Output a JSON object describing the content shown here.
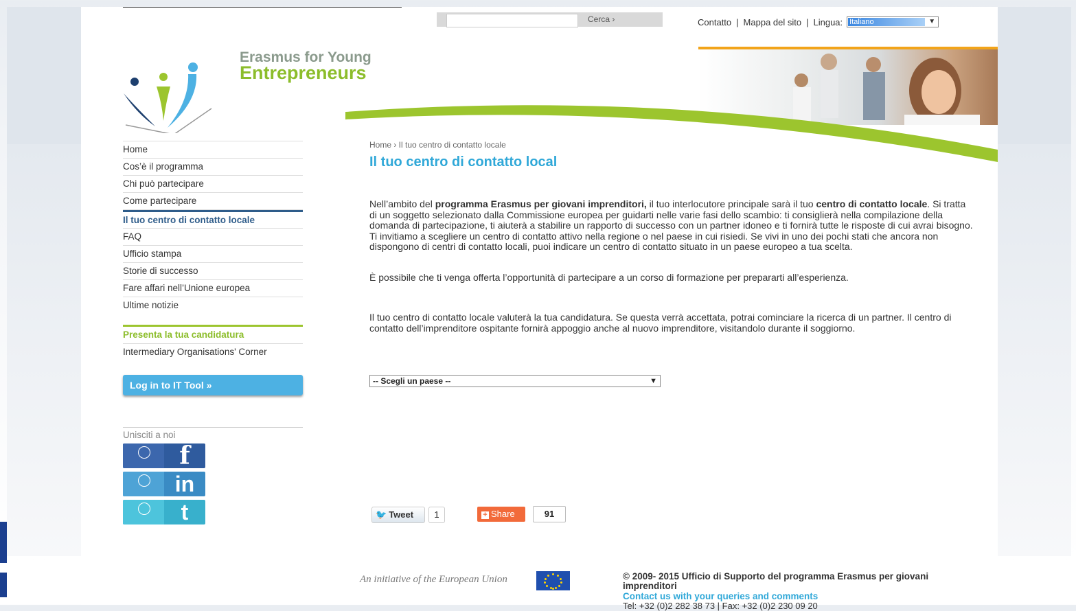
{
  "search": {
    "button": "Cerca ›"
  },
  "top_links": {
    "contact": "Contatto",
    "sitemap": "Mappa del sito",
    "language_label": "Lingua:",
    "language_value": "Italiano",
    "separator": "|"
  },
  "logo": {
    "line1": "Erasmus for Young",
    "line2": "Entrepreneurs"
  },
  "nav": {
    "items": [
      "Home",
      "Cos’è il programma",
      "Chi può partecipare",
      "Come partecipare",
      "Il tuo centro di contatto locale",
      "FAQ",
      "Ufficio stampa",
      "Storie di successo",
      "Fare affari nell’Unione europea",
      "Ultime notizie"
    ],
    "active_index": 4
  },
  "apply": {
    "primary": "Presenta la tua candidatura",
    "secondary": "Intermediary Organisations' Corner"
  },
  "login": {
    "label": "Log in to IT Tool »"
  },
  "join": {
    "label": "Unisciti a noi"
  },
  "social": {
    "facebook_glyph": "f",
    "linkedin_glyph": "in",
    "twitter_glyph": "t",
    "logo_caption": "Erasmus for Young Entrepreneurs"
  },
  "content": {
    "breadcrumb": "Home › Il tuo centro di contatto locale",
    "title": "Il tuo centro di contatto local",
    "p1_a": "Nell’ambito del ",
    "p1_b": "programma Erasmus per giovani imprenditori,",
    "p1_c": " il tuo interlocutore principale sarà il tuo ",
    "p1_d": "centro di contatto locale",
    "p1_e": ". Si tratta di un soggetto selezionato dalla Commissione europea per guidarti nelle varie fasi dello scambio: ti consiglierà nella compilazione della domanda di partecipazione, ti aiuterà a stabilire un rapporto di successo con un partner idoneo e ti fornirà tutte le risposte di cui avrai bisogno. Ti invitiamo a scegliere un centro di contatto attivo nella regione o nel paese in cui risiedi. Se vivi in uno dei pochi stati che ancora non dispongono di centri di contatto locali, puoi indicare un centro di contatto situato in un paese europeo a tua scelta.",
    "p2": "È possibile che ti venga offerta l’opportunità di partecipare a un corso di formazione per prepararti all’esperienza.",
    "p3": "Il tuo centro di contatto locale valuterà la tua candidatura. Se questa verrà accettata, potrai cominciare la ricerca di un partner. Il centro di contatto dell’imprenditore ospitante fornirà appoggio anche al nuovo imprenditore, visitandolo durante il soggiorno.",
    "country_select": "-- Scegli un paese --"
  },
  "share": {
    "tweet": "Tweet",
    "tweet_count": "1",
    "share": "Share",
    "share_count": "91"
  },
  "footer": {
    "initiative": "An initiative of the European Union",
    "copyright": "© 2009- 2015 Ufficio di Supporto del programma Erasmus per giovani imprenditori",
    "contact_link": "Contact us with your queries and comments",
    "tel": "Tel: +32 (0)2 282 38 73 | Fax: +32 (0)2 230 09 20"
  },
  "colors": {
    "accent_green": "#8cbd2b",
    "accent_blue": "#30a8d8",
    "nav_active": "#2e5c8a",
    "orange": "#f2a41a"
  }
}
